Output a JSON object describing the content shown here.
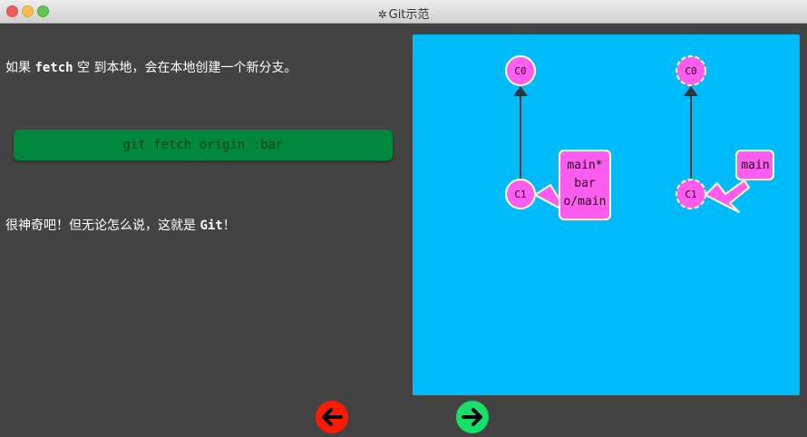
{
  "window": {
    "title": "Git示范",
    "gear_icon": "gear-icon"
  },
  "intro": {
    "before": "如果 ",
    "keyword": "fetch",
    "after": " 空 到本地，会在本地创建一个新分支。"
  },
  "command": "git fetch origin :bar",
  "outro": {
    "before": "很神奇吧！但无论怎么说，这就是 ",
    "keyword": "Git",
    "after": "！"
  },
  "local_repo": {
    "commits": [
      "C0",
      "C1"
    ],
    "branch_labels": [
      "main*",
      "bar",
      "o/main"
    ]
  },
  "remote_repo": {
    "commits": [
      "C0",
      "C1"
    ],
    "branch_labels": [
      "main"
    ]
  },
  "nav": {
    "prev_icon": "arrow-left-icon",
    "next_icon": "arrow-right-icon"
  },
  "colors": {
    "visual_bg": "#00bbfa",
    "commit_fill": "#ff5cf0",
    "command_bg": "#00893e",
    "prev_button": "#ff1a00",
    "next_button": "#17e06a"
  }
}
